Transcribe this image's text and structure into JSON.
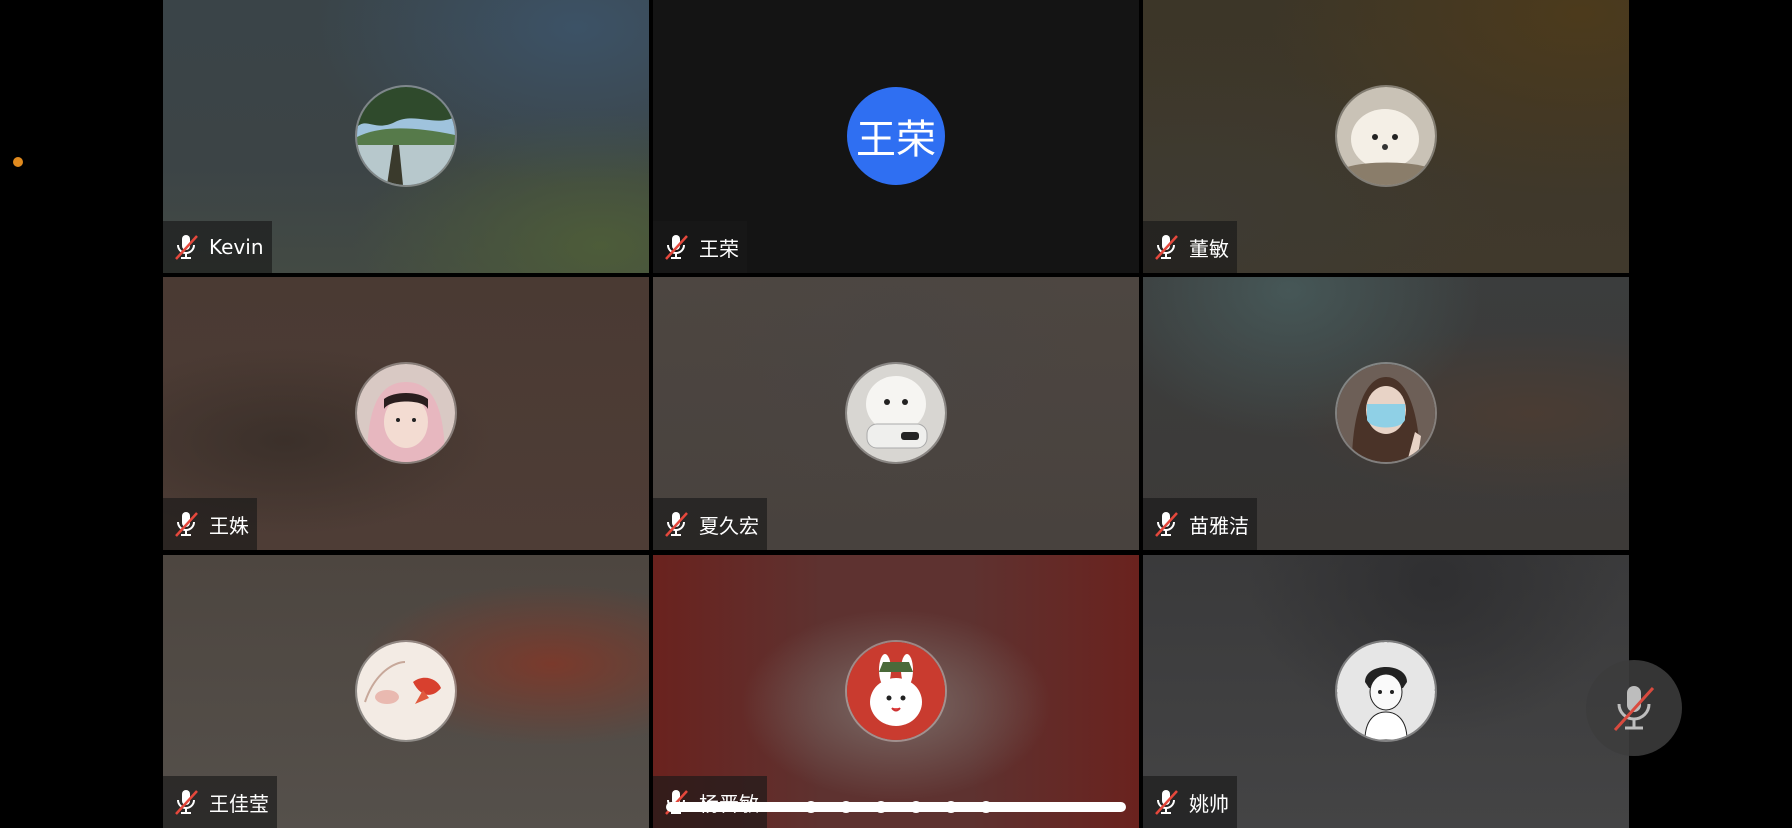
{
  "participants": [
    {
      "name": "Kevin",
      "avatar": "lake-photo",
      "muted": true
    },
    {
      "name": "王荣",
      "avatar_initials": "王荣",
      "avatar_color": "#2f6ff2",
      "muted": true
    },
    {
      "name": "董敏",
      "avatar": "white-puppy-photo",
      "muted": true
    },
    {
      "name": "王姝",
      "avatar": "girl-pink-hood-photo",
      "muted": true
    },
    {
      "name": "夏久宏",
      "avatar": "white-dog-phone-photo",
      "muted": true
    },
    {
      "name": "苗雅洁",
      "avatar": "girl-mask-photo",
      "muted": true
    },
    {
      "name": "王佳莹",
      "avatar": "illustrated-girl-goldfish",
      "muted": true
    },
    {
      "name": "杨晋敏",
      "avatar": "cartoon-rabbit",
      "muted": true
    },
    {
      "name": "姚帅",
      "avatar": "manga-boy",
      "muted": true
    }
  ],
  "controls": {
    "floating_mic": "mic-muted-icon"
  },
  "colors": {
    "accent": "#2f6ff2",
    "status_dot": "#e08a1e",
    "muted_slash": "#e5483c"
  }
}
